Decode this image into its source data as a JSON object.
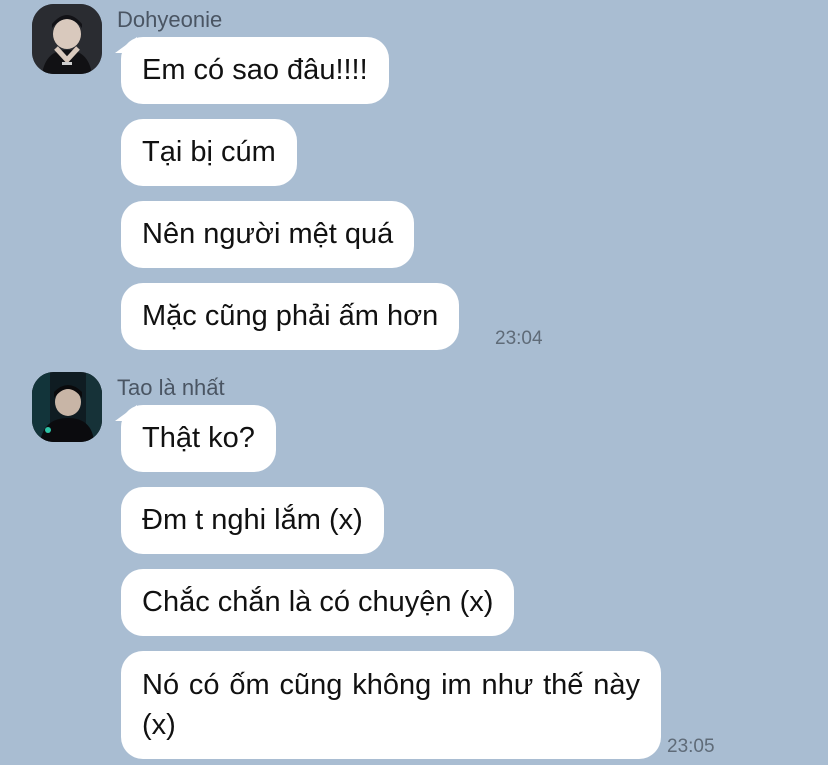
{
  "conversation": [
    {
      "sender": "Dohyeonie",
      "avatar_icon": "user-avatar-dohyeonie-icon",
      "messages": [
        "Em có sao đâu!!!!",
        "Tại bị cúm",
        "Nên người mệt quá",
        "Mặc cũng phải ấm hơn"
      ],
      "time": "23:04"
    },
    {
      "sender": "Tao là nhất",
      "avatar_icon": "user-avatar-tao-la-nhat-icon",
      "messages": [
        "Thật ko?",
        "Đm t nghi lắm (x)",
        "Chắc chắn là có chuyện (x)",
        "Nó có ốm cũng không im như thế này (x)"
      ],
      "time": "23:05"
    }
  ],
  "colors": {
    "background": "#a9bdd2",
    "bubble": "#ffffff",
    "sender_text": "#4a5563",
    "time_text": "#5f6b78"
  }
}
